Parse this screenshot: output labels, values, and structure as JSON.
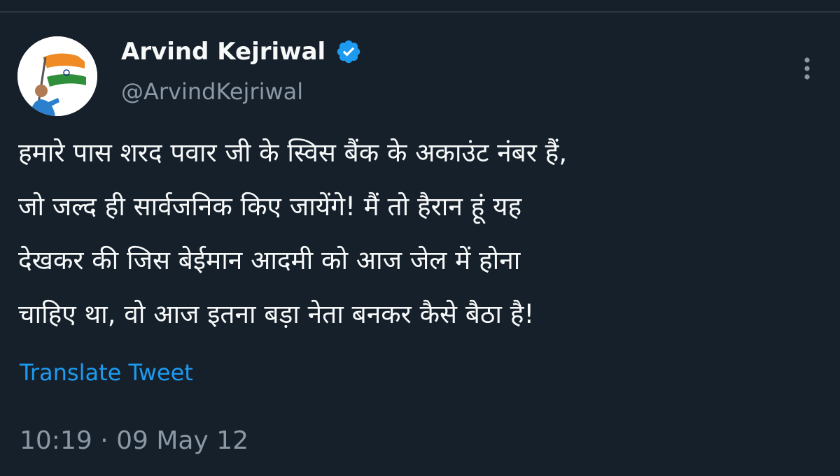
{
  "author": {
    "display_name": "Arvind Kejriwal",
    "handle": "@ArvindKejriwal",
    "verified_icon": "verified-badge-icon",
    "avatar_icon": "profile-photo-with-flag"
  },
  "tweet": {
    "lines": [
      "हमारे पास शरद पवार जी के स्विस बैंक के अकाउंट नंबर हैं,",
      "जो जल्द ही सार्वजनिक किए जायेंगे! मैं तो हैरान हूं यह",
      "देखकर की जिस बेईमान आदमी को आज जेल में होना",
      "चाहिए था, वो आज इतना बड़ा नेता बनकर कैसे बैठा है!"
    ],
    "translate_label": "Translate Tweet",
    "timestamp": "10:19 · 09 May 12"
  },
  "menu": {
    "icon": "more-vertical-icon"
  },
  "colors": {
    "background": "#15202b",
    "text": "#f7f9f9",
    "muted": "#8b98a5",
    "accent": "#1d9bf0"
  }
}
